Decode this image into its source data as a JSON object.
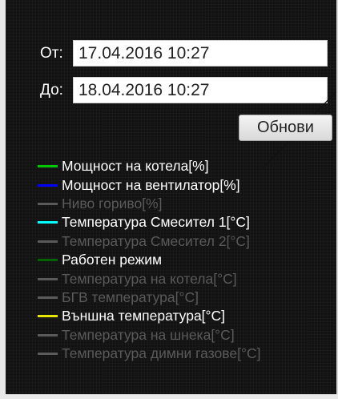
{
  "range": {
    "from_label": "От:",
    "from_value": "17.04.2016 10:27",
    "to_label": "До:",
    "to_value": "18.04.2016 10:27",
    "refresh_label": "Обнови"
  },
  "legend": {
    "items": [
      {
        "label": "Мощност на котела[%]",
        "color": "#00c800",
        "active": true
      },
      {
        "label": "Мощност на вентилатор[%]",
        "color": "#0000ff",
        "active": true
      },
      {
        "label": "Ниво гориво[%]",
        "color": "#5a5a5a",
        "active": false
      },
      {
        "label": "Температура Смесител 1[°C]",
        "color": "#00ffff",
        "active": true
      },
      {
        "label": "Температура Смесител 2[°C]",
        "color": "#5a5a5a",
        "active": false
      },
      {
        "label": "Работен режим",
        "color": "#006400",
        "active": true
      },
      {
        "label": "Температура на котела[°C]",
        "color": "#5a5a5a",
        "active": false
      },
      {
        "label": "БГВ температура[°C]",
        "color": "#5a5a5a",
        "active": false
      },
      {
        "label": "Външна температура[°C]",
        "color": "#e6e600",
        "active": true
      },
      {
        "label": "Температура на шнека[°C]",
        "color": "#5a5a5a",
        "active": false
      },
      {
        "label": "Температура димни газове[°C]",
        "color": "#5a5a5a",
        "active": false
      }
    ]
  }
}
